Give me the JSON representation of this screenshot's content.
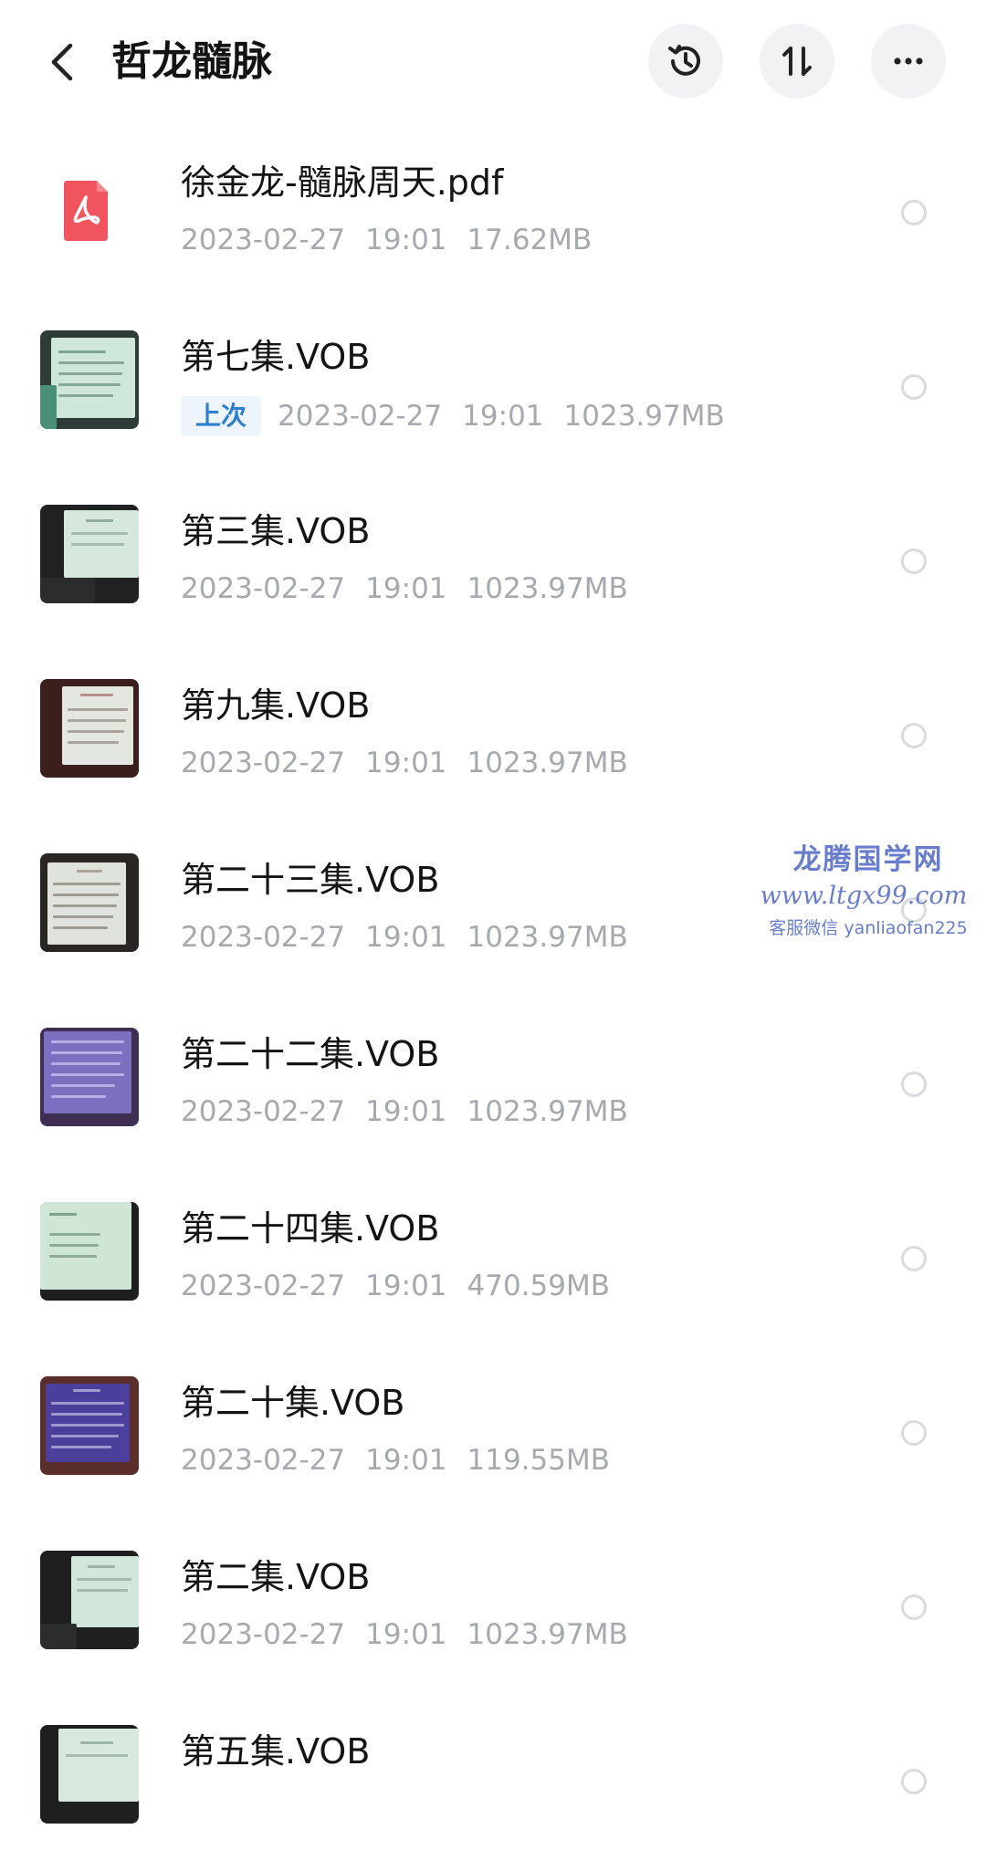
{
  "header": {
    "title": "哲龙髓脉",
    "icons": {
      "back": "chevron-left-icon",
      "history": "history-icon",
      "sort": "sort-icon",
      "more": "more-icon"
    }
  },
  "files": [
    {
      "name": "徐金龙-髓脉周天.pdf",
      "badge": "",
      "date": "2023-02-27",
      "time": "19:01",
      "size": "17.62MB",
      "type": "pdf"
    },
    {
      "name": "第七集.VOB",
      "badge": "上次",
      "date": "2023-02-27",
      "time": "19:01",
      "size": "1023.97MB",
      "type": "video"
    },
    {
      "name": "第三集.VOB",
      "badge": "",
      "date": "2023-02-27",
      "time": "19:01",
      "size": "1023.97MB",
      "type": "video"
    },
    {
      "name": "第九集.VOB",
      "badge": "",
      "date": "2023-02-27",
      "time": "19:01",
      "size": "1023.97MB",
      "type": "video"
    },
    {
      "name": "第二十三集.VOB",
      "badge": "",
      "date": "2023-02-27",
      "time": "19:01",
      "size": "1023.97MB",
      "type": "video"
    },
    {
      "name": "第二十二集.VOB",
      "badge": "",
      "date": "2023-02-27",
      "time": "19:01",
      "size": "1023.97MB",
      "type": "video"
    },
    {
      "name": "第二十四集.VOB",
      "badge": "",
      "date": "2023-02-27",
      "time": "19:01",
      "size": "470.59MB",
      "type": "video"
    },
    {
      "name": "第二十集.VOB",
      "badge": "",
      "date": "2023-02-27",
      "time": "19:01",
      "size": "119.55MB",
      "type": "video"
    },
    {
      "name": "第二集.VOB",
      "badge": "",
      "date": "2023-02-27",
      "time": "19:01",
      "size": "1023.97MB",
      "type": "video"
    },
    {
      "name": "第五集.VOB",
      "badge": "",
      "date": "",
      "time": "",
      "size": "",
      "type": "video"
    }
  ],
  "watermark": {
    "line1": "龙腾国学网",
    "line2": "www.ltgx99.com",
    "line3": "客服微信 yanliaofan225"
  },
  "colors": {
    "accent": "#2f7fd0",
    "pdf": "#f0555f",
    "watermark": "#4e67c4",
    "meta_text": "#a6a9ae"
  }
}
